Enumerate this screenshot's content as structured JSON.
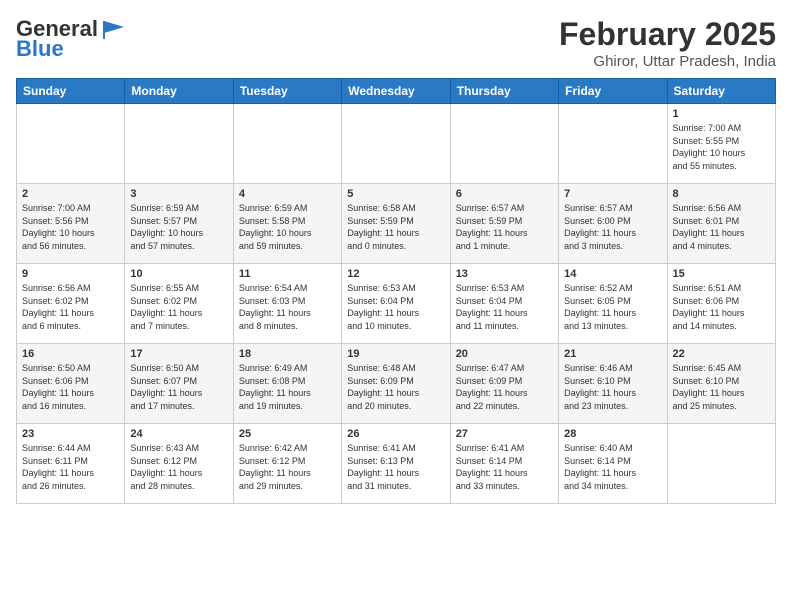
{
  "header": {
    "logo_line1": "General",
    "logo_line2": "Blue",
    "title": "February 2025",
    "subtitle": "Ghiror, Uttar Pradesh, India"
  },
  "weekdays": [
    "Sunday",
    "Monday",
    "Tuesday",
    "Wednesday",
    "Thursday",
    "Friday",
    "Saturday"
  ],
  "weeks": [
    [
      {
        "day": "",
        "info": ""
      },
      {
        "day": "",
        "info": ""
      },
      {
        "day": "",
        "info": ""
      },
      {
        "day": "",
        "info": ""
      },
      {
        "day": "",
        "info": ""
      },
      {
        "day": "",
        "info": ""
      },
      {
        "day": "1",
        "info": "Sunrise: 7:00 AM\nSunset: 5:55 PM\nDaylight: 10 hours\nand 55 minutes."
      }
    ],
    [
      {
        "day": "2",
        "info": "Sunrise: 7:00 AM\nSunset: 5:56 PM\nDaylight: 10 hours\nand 56 minutes."
      },
      {
        "day": "3",
        "info": "Sunrise: 6:59 AM\nSunset: 5:57 PM\nDaylight: 10 hours\nand 57 minutes."
      },
      {
        "day": "4",
        "info": "Sunrise: 6:59 AM\nSunset: 5:58 PM\nDaylight: 10 hours\nand 59 minutes."
      },
      {
        "day": "5",
        "info": "Sunrise: 6:58 AM\nSunset: 5:59 PM\nDaylight: 11 hours\nand 0 minutes."
      },
      {
        "day": "6",
        "info": "Sunrise: 6:57 AM\nSunset: 5:59 PM\nDaylight: 11 hours\nand 1 minute."
      },
      {
        "day": "7",
        "info": "Sunrise: 6:57 AM\nSunset: 6:00 PM\nDaylight: 11 hours\nand 3 minutes."
      },
      {
        "day": "8",
        "info": "Sunrise: 6:56 AM\nSunset: 6:01 PM\nDaylight: 11 hours\nand 4 minutes."
      }
    ],
    [
      {
        "day": "9",
        "info": "Sunrise: 6:56 AM\nSunset: 6:02 PM\nDaylight: 11 hours\nand 6 minutes."
      },
      {
        "day": "10",
        "info": "Sunrise: 6:55 AM\nSunset: 6:02 PM\nDaylight: 11 hours\nand 7 minutes."
      },
      {
        "day": "11",
        "info": "Sunrise: 6:54 AM\nSunset: 6:03 PM\nDaylight: 11 hours\nand 8 minutes."
      },
      {
        "day": "12",
        "info": "Sunrise: 6:53 AM\nSunset: 6:04 PM\nDaylight: 11 hours\nand 10 minutes."
      },
      {
        "day": "13",
        "info": "Sunrise: 6:53 AM\nSunset: 6:04 PM\nDaylight: 11 hours\nand 11 minutes."
      },
      {
        "day": "14",
        "info": "Sunrise: 6:52 AM\nSunset: 6:05 PM\nDaylight: 11 hours\nand 13 minutes."
      },
      {
        "day": "15",
        "info": "Sunrise: 6:51 AM\nSunset: 6:06 PM\nDaylight: 11 hours\nand 14 minutes."
      }
    ],
    [
      {
        "day": "16",
        "info": "Sunrise: 6:50 AM\nSunset: 6:06 PM\nDaylight: 11 hours\nand 16 minutes."
      },
      {
        "day": "17",
        "info": "Sunrise: 6:50 AM\nSunset: 6:07 PM\nDaylight: 11 hours\nand 17 minutes."
      },
      {
        "day": "18",
        "info": "Sunrise: 6:49 AM\nSunset: 6:08 PM\nDaylight: 11 hours\nand 19 minutes."
      },
      {
        "day": "19",
        "info": "Sunrise: 6:48 AM\nSunset: 6:09 PM\nDaylight: 11 hours\nand 20 minutes."
      },
      {
        "day": "20",
        "info": "Sunrise: 6:47 AM\nSunset: 6:09 PM\nDaylight: 11 hours\nand 22 minutes."
      },
      {
        "day": "21",
        "info": "Sunrise: 6:46 AM\nSunset: 6:10 PM\nDaylight: 11 hours\nand 23 minutes."
      },
      {
        "day": "22",
        "info": "Sunrise: 6:45 AM\nSunset: 6:10 PM\nDaylight: 11 hours\nand 25 minutes."
      }
    ],
    [
      {
        "day": "23",
        "info": "Sunrise: 6:44 AM\nSunset: 6:11 PM\nDaylight: 11 hours\nand 26 minutes."
      },
      {
        "day": "24",
        "info": "Sunrise: 6:43 AM\nSunset: 6:12 PM\nDaylight: 11 hours\nand 28 minutes."
      },
      {
        "day": "25",
        "info": "Sunrise: 6:42 AM\nSunset: 6:12 PM\nDaylight: 11 hours\nand 29 minutes."
      },
      {
        "day": "26",
        "info": "Sunrise: 6:41 AM\nSunset: 6:13 PM\nDaylight: 11 hours\nand 31 minutes."
      },
      {
        "day": "27",
        "info": "Sunrise: 6:41 AM\nSunset: 6:14 PM\nDaylight: 11 hours\nand 33 minutes."
      },
      {
        "day": "28",
        "info": "Sunrise: 6:40 AM\nSunset: 6:14 PM\nDaylight: 11 hours\nand 34 minutes."
      },
      {
        "day": "",
        "info": ""
      }
    ]
  ]
}
